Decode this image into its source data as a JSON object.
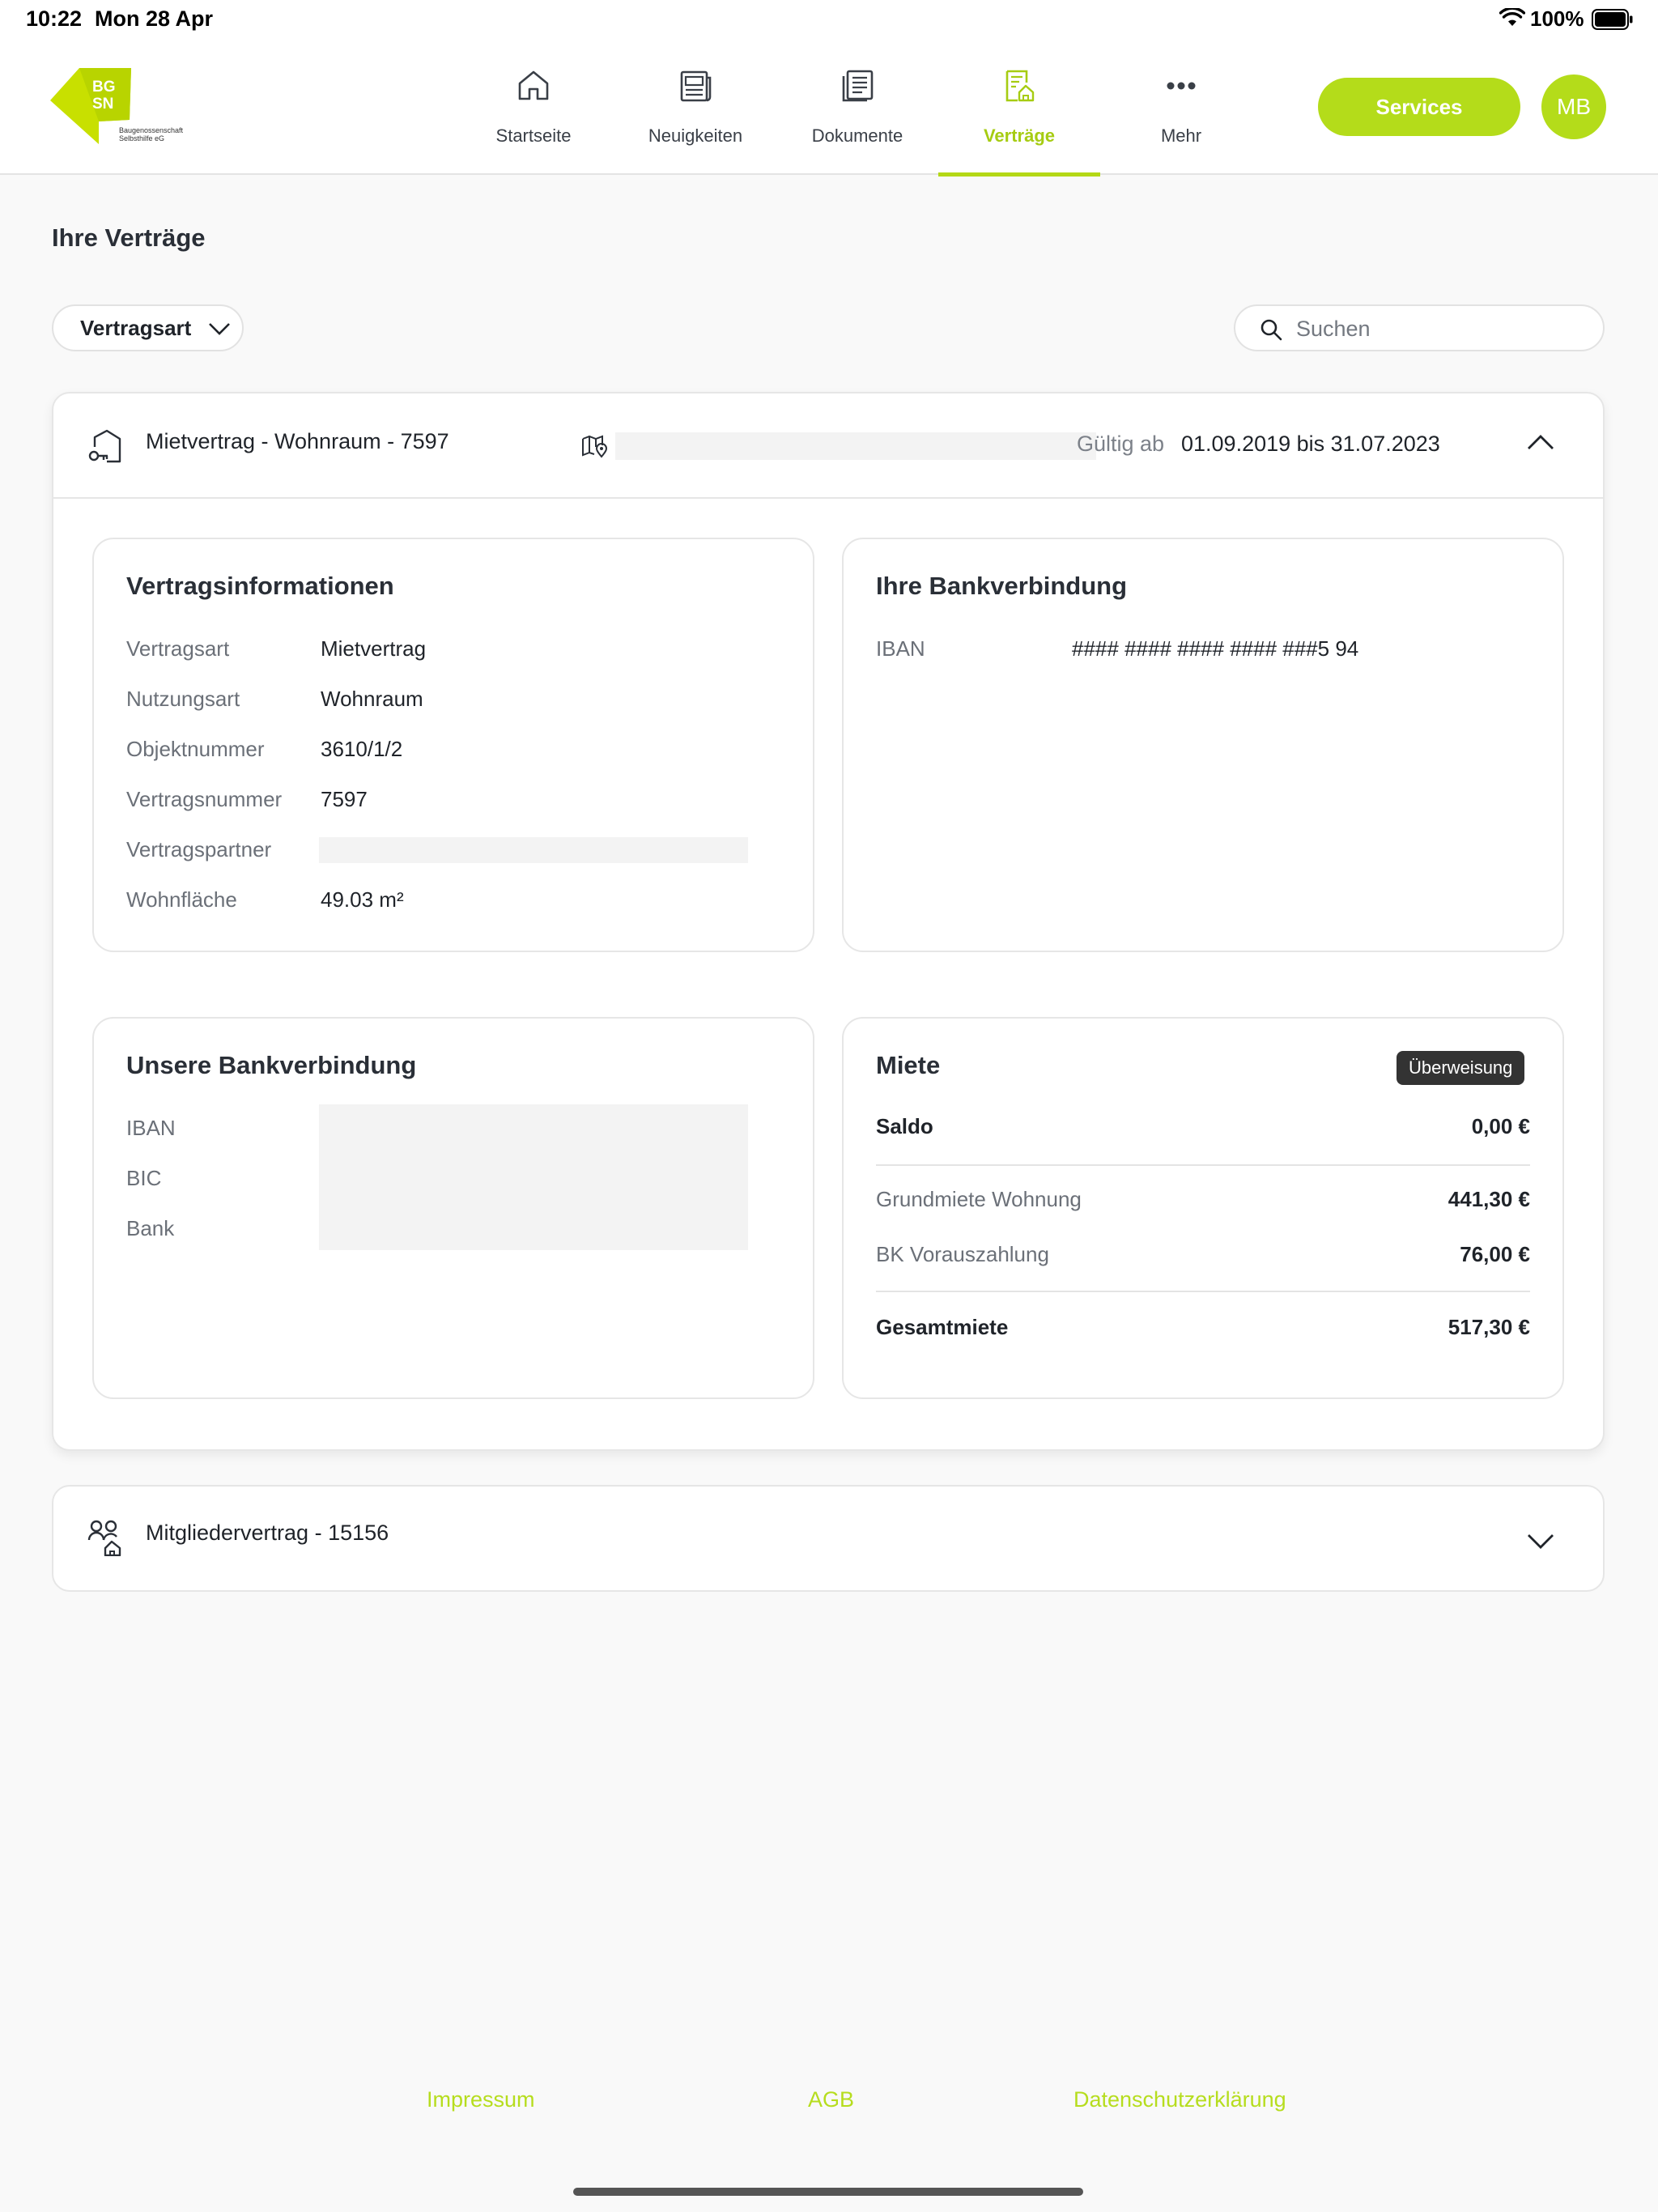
{
  "status_bar": {
    "time": "10:22",
    "date": "Mon 28 Apr",
    "battery": "100%"
  },
  "header": {
    "logo": {
      "letters": "BG SN",
      "subtitle_line1": "Baugenossenschaft",
      "subtitle_line2": "Selbsthilfe eG"
    },
    "nav": [
      {
        "label": "Startseite",
        "icon": "home-icon",
        "active": false
      },
      {
        "label": "Neuigkeiten",
        "icon": "news-icon",
        "active": false
      },
      {
        "label": "Dokumente",
        "icon": "documents-icon",
        "active": false
      },
      {
        "label": "Verträge",
        "icon": "contracts-icon",
        "active": true
      },
      {
        "label": "Mehr",
        "icon": "more-icon",
        "active": false
      }
    ],
    "services_label": "Services",
    "avatar_initials": "MB"
  },
  "page": {
    "title": "Ihre Verträge",
    "filter_label": "Vertragsart",
    "search_placeholder": "Suchen"
  },
  "contract": {
    "title": "Mietvertrag - Wohnraum - 7597",
    "valid_label": "Gültig ab",
    "valid_range": "01.09.2019 bis 31.07.2023",
    "info": {
      "heading": "Vertragsinformationen",
      "rows": [
        {
          "label": "Vertragsart",
          "value": "Mietvertrag"
        },
        {
          "label": "Nutzungsart",
          "value": "Wohnraum"
        },
        {
          "label": "Objektnummer",
          "value": "3610/1/2"
        },
        {
          "label": "Vertragsnummer",
          "value": "7597"
        },
        {
          "label": "Vertragspartner",
          "value": ""
        },
        {
          "label": "Wohnfläche",
          "value": "49.03 m²"
        }
      ]
    },
    "your_bank": {
      "heading": "Ihre Bankverbindung",
      "iban_label": "IBAN",
      "iban_value": "#### #### #### #### ###5 94"
    },
    "our_bank": {
      "heading": "Unsere Bankverbindung",
      "labels": [
        "IBAN",
        "BIC",
        "Bank"
      ]
    },
    "rent": {
      "heading": "Miete",
      "badge": "Überweisung",
      "saldo_label": "Saldo",
      "saldo_value": "0,00 €",
      "items": [
        {
          "label": "Grundmiete Wohnung",
          "value": "441,30 €"
        },
        {
          "label": "BK Vorauszahlung",
          "value": "76,00 €"
        }
      ],
      "total_label": "Gesamtmiete",
      "total_value": "517,30 €"
    }
  },
  "member_contract": {
    "title": "Mitgliedervertrag - 15156"
  },
  "footer": {
    "links": [
      "Impressum",
      "AGB",
      "Datenschutzerklärung"
    ]
  },
  "colors": {
    "accent": "#b4dc1a",
    "accent_text": "#a6cc12",
    "badge_bg": "#333333"
  }
}
